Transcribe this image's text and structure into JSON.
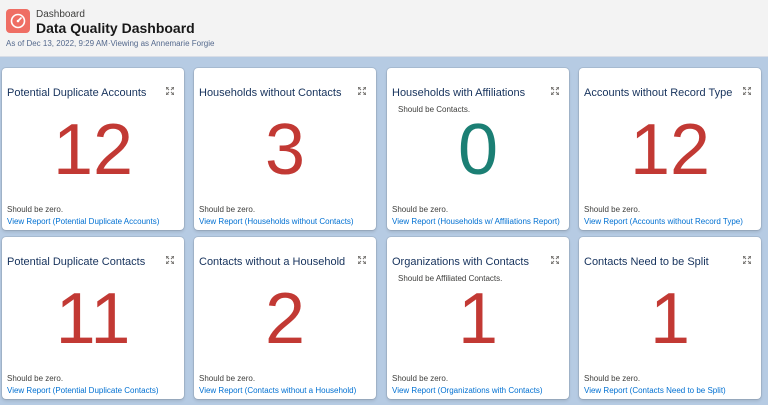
{
  "header": {
    "eyebrow": "Dashboard",
    "title": "Data Quality Dashboard",
    "subline": "As of Dec 13, 2022, 9:29 AM·Viewing as Annemarie Forgie"
  },
  "cards": [
    {
      "title": "Potential Duplicate Accounts",
      "desc": "",
      "value": "12",
      "note": "Should be zero.",
      "link": "View Report (Potential Duplicate Accounts)"
    },
    {
      "title": "Households without Contacts",
      "desc": "",
      "value": "3",
      "note": "Should be zero.",
      "link": "View Report (Households without Contacts)"
    },
    {
      "title": "Households with Affiliations",
      "desc": "Should be Contacts.",
      "value": "0",
      "note": "Should be zero.",
      "link": "View Report (Households w/ Affiliations Report)"
    },
    {
      "title": "Accounts without Record Type",
      "desc": "",
      "value": "12",
      "note": "Should be zero.",
      "link": "View Report (Accounts without Record Type)"
    },
    {
      "title": "Potential Duplicate Contacts",
      "desc": "",
      "value": "11",
      "note": "Should be zero.",
      "link": "View Report (Potential Duplicate Contacts)"
    },
    {
      "title": "Contacts without a Household",
      "desc": "",
      "value": "2",
      "note": "Should be zero.",
      "link": "View Report (Contacts without a Household)"
    },
    {
      "title": "Organizations with Contacts",
      "desc": "Should be Affiliated Contacts.",
      "value": "1",
      "note": "Should be zero.",
      "link": "View Report (Organizations with Contacts)"
    },
    {
      "title": "Contacts Need to be Split",
      "desc": "",
      "value": "1",
      "note": "Should be zero.",
      "link": "View Report (Contacts Need to be Split)"
    }
  ],
  "colors": {
    "alert": "#c23934",
    "ok": "#1b7f74",
    "link": "#0070d2",
    "app_icon": "#ef6e64"
  }
}
